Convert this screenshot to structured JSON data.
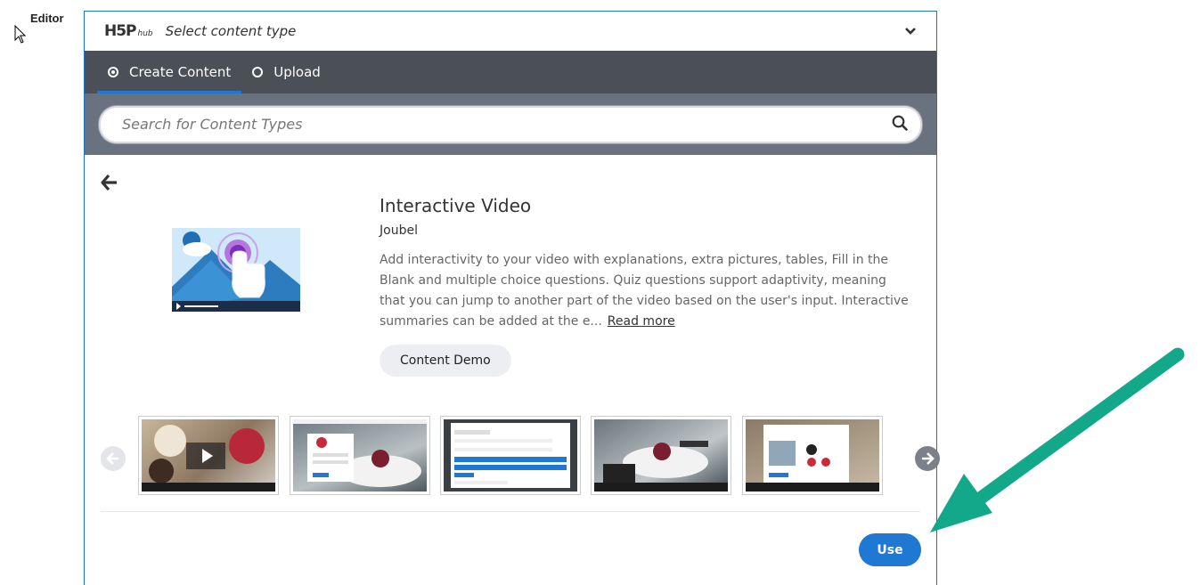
{
  "editor_label": "Editor",
  "hub": {
    "logo_main": "H5P",
    "logo_sub": "hub",
    "title": "Select content type"
  },
  "tabs": [
    {
      "label": "Create Content",
      "selected": true
    },
    {
      "label": "Upload",
      "selected": false
    }
  ],
  "search": {
    "placeholder": "Search for Content Types",
    "value": ""
  },
  "detail": {
    "title": "Interactive Video",
    "author": "Joubel",
    "description": "Add interactivity to your video with explanations, extra pictures, tables, Fill in the Blank and multiple choice questions. Quiz questions support adaptivity, meaning that you can jump to another part of the video based on the user's input. Interactive summaries can be added at the e...",
    "read_more": "Read more",
    "demo_button": "Content Demo"
  },
  "use_button": "Use",
  "colors": {
    "accent": "#1f78d1",
    "tabbar": "#4b4f57",
    "searchbar": "#6a7280",
    "annotation_arrow": "#13a889"
  },
  "icons": [
    "cursor-icon",
    "chevron-down-icon",
    "search-icon",
    "back-arrow-icon",
    "carousel-prev-icon",
    "carousel-next-icon"
  ]
}
